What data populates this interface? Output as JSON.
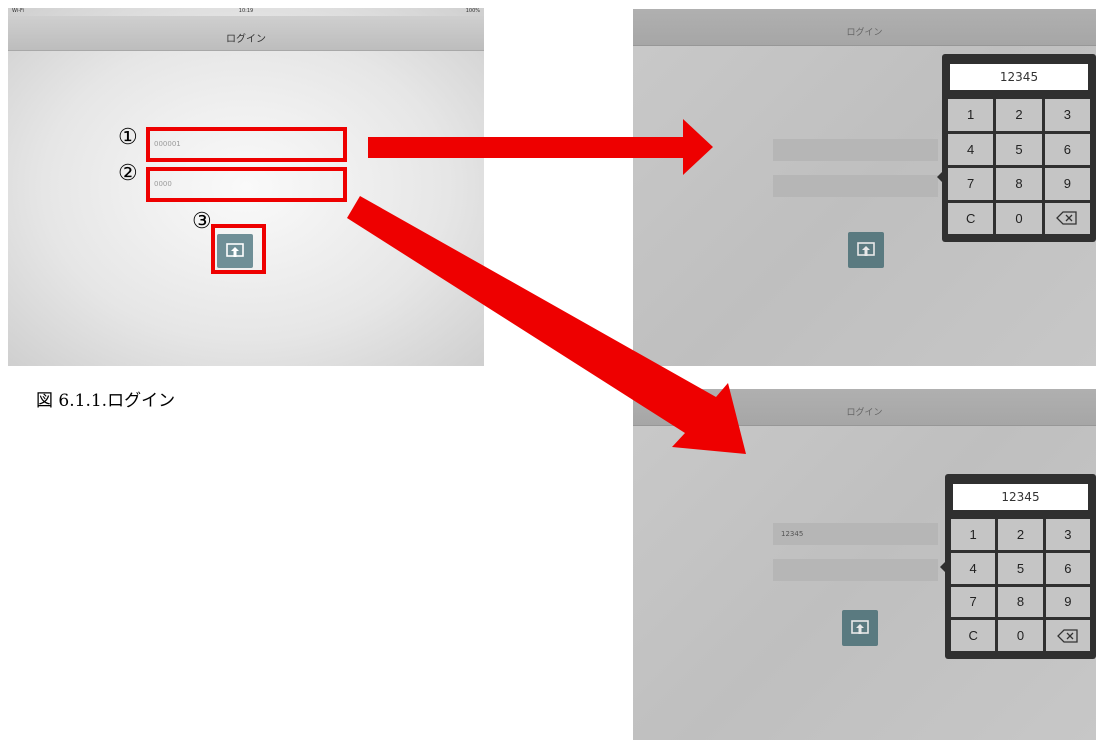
{
  "screen_login": {
    "status_left": "Wi-Fi",
    "status_center": "10:19",
    "status_right": "100%",
    "title": "ログイン",
    "user_id_value": "000001",
    "password_value": "0000",
    "login_icon": "login-upload-icon"
  },
  "annotations": {
    "marker1": "①",
    "marker2": "②",
    "marker3": "③",
    "highlight_color": "#ee0000"
  },
  "caption": "図 6.1.1.ログイン",
  "screen_keypad_top": {
    "title": "ログイン",
    "display_value": "12345",
    "field1_value": "",
    "field2_value": ""
  },
  "screen_keypad_bottom": {
    "title": "ログイン",
    "display_value": "12345",
    "field1_value": "12345",
    "field2_value": ""
  },
  "keypad": {
    "keys": [
      "1",
      "2",
      "3",
      "4",
      "5",
      "6",
      "7",
      "8",
      "9",
      "C",
      "0"
    ],
    "backspace_icon": "backspace-icon"
  }
}
